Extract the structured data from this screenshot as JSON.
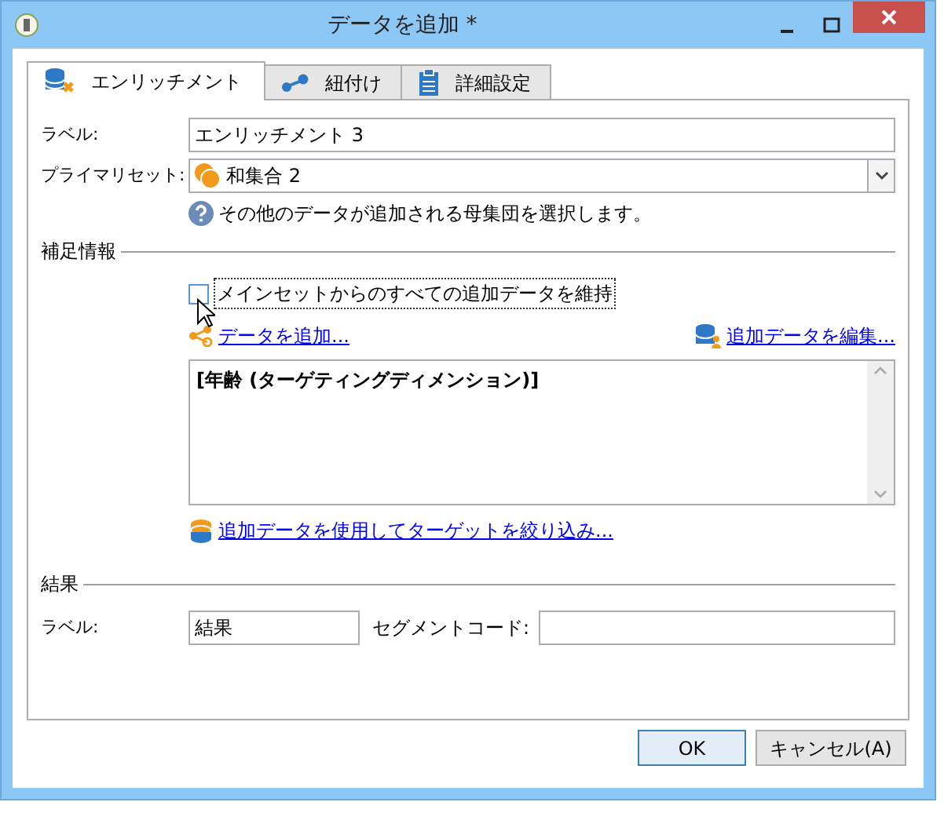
{
  "window": {
    "title": "データを追加 *"
  },
  "tabs": [
    {
      "label": "エンリッチメント",
      "selected": true
    },
    {
      "label": "紐付け",
      "selected": false
    },
    {
      "label": "詳細設定",
      "selected": false
    }
  ],
  "label_field": {
    "label": "ラベル:",
    "value": "エンリッチメント 3"
  },
  "primary_set": {
    "label": "プライマリセット:",
    "value": "和集合 2",
    "help": "その他のデータが追加される母集団を選択します。"
  },
  "supplement": {
    "heading": "補足情報",
    "keep_all": {
      "label": "メインセットからのすべての追加データを維持",
      "checked": false
    },
    "add_link": "データを追加...",
    "edit_link": "追加データを編集...",
    "expression": "[年齢 (ターゲティングディメンション)]",
    "filter_link": "追加データを使用してターゲットを絞り込み..."
  },
  "result": {
    "heading": "結果",
    "label": "ラベル:",
    "value": "結果",
    "segment_label": "セグメントコード:"
  },
  "buttons": [
    {
      "label": "OK",
      "default": true
    },
    {
      "label": "キャンセル(A)",
      "default": false
    }
  ]
}
